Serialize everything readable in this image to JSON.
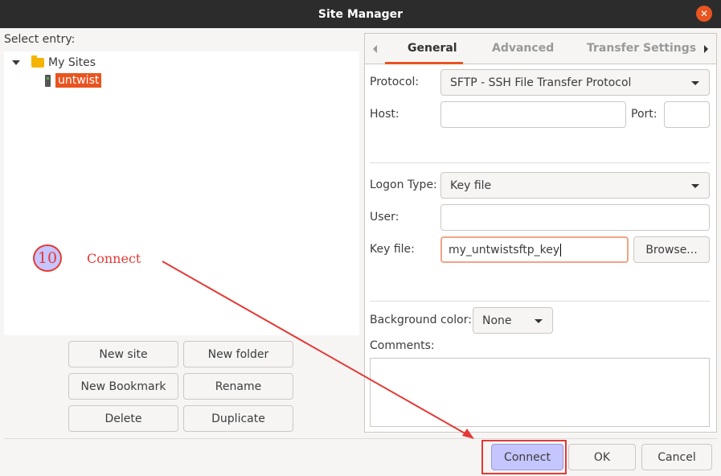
{
  "window": {
    "title": "Site Manager",
    "close_icon": "x"
  },
  "left": {
    "select_label": "Select entry:",
    "tree": [
      {
        "label": "My Sites",
        "type": "folder",
        "expanded": true
      },
      {
        "label": "untwist",
        "type": "site",
        "selected": true
      }
    ],
    "buttons": {
      "new_site": "New site",
      "new_folder": "New folder",
      "new_bookmark": "New Bookmark",
      "rename": "Rename",
      "delete": "Delete",
      "duplicate": "Duplicate"
    }
  },
  "tabs": [
    {
      "label": "General",
      "active": true
    },
    {
      "label": "Advanced",
      "active": false
    },
    {
      "label": "Transfer Settings",
      "active": false
    }
  ],
  "general": {
    "protocol_label": "Protocol:",
    "protocol_value": "SFTP - SSH File Transfer Protocol",
    "host_label": "Host:",
    "host_value": "",
    "port_label": "Port:",
    "port_value": "",
    "logon_type_label": "Logon Type:",
    "logon_type_value": "Key file",
    "user_label": "User:",
    "user_value": "",
    "key_file_label": "Key file:",
    "key_file_value": "my_untwistsftp_key",
    "browse_label": "Browse...",
    "bg_color_label": "Background color:",
    "bg_color_value": "None",
    "comments_label": "Comments:",
    "comments_value": ""
  },
  "footer": {
    "connect": "Connect",
    "ok": "OK",
    "cancel": "Cancel"
  },
  "annotation": {
    "step_number": "10",
    "text": "Connect",
    "color": "#e53935"
  },
  "colors": {
    "accent": "#e95420",
    "highlight": "#c5c5ff"
  }
}
